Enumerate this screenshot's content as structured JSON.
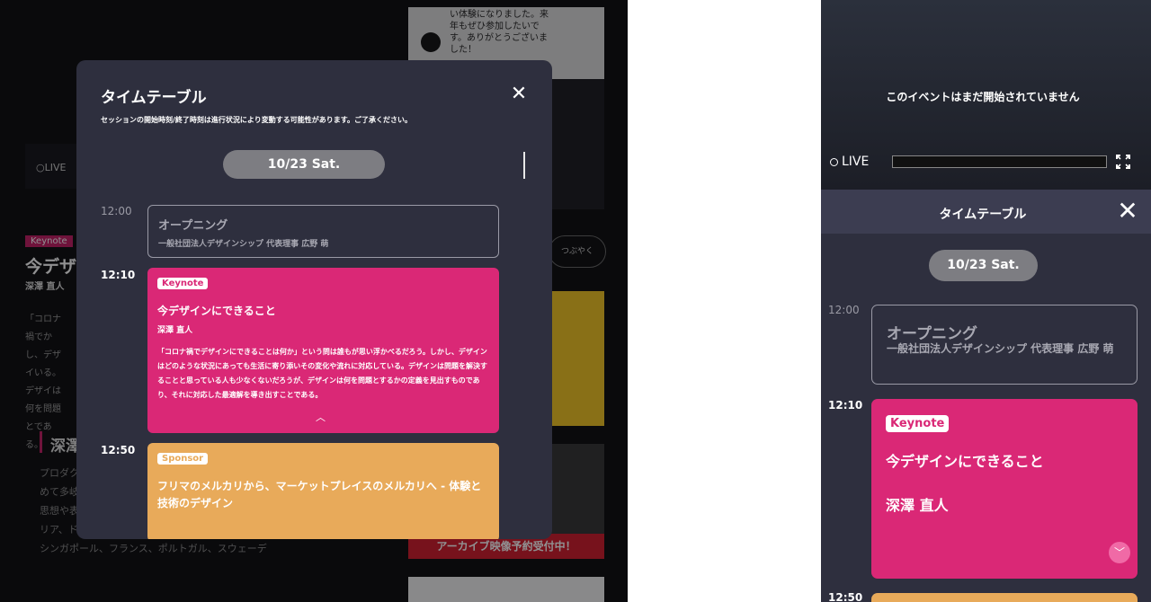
{
  "background": {
    "live_label": "LIVE",
    "badge": "Keynote",
    "title": "今デザイ",
    "speaker": "深澤 直人",
    "para": "「コロナ禍でかし、デザイいる。デザイは何を問題とである。",
    "section_heading": "深澤",
    "bio": "プロダクトを経てサ る。200 のあるデ まで手がけるデザインの領域は極めて多岐に渡る。デザインの本質 ンを通して対象の本質にせまる力、その思想や表現などには国や領域を超えて高 い評価を得ている。現在は、イタリア、ドイツ、アメリカ、スイス、スペイン、 中国、韓国、タイ、台湾、シンガポール、フランス、ポルトガル、スウェーデ",
    "chat_text": "い体験になりました。来年もぜひ参加したいです。ありがとうございました！",
    "tweet_label": "つぶやく",
    "archive_label": "アーカイブ映像予約受付中！"
  },
  "modal": {
    "title": "タイムテーブル",
    "note": "セッションの開始時刻/終了時刻は進行状況により変動する可能性があります。ご了承ください。",
    "date": "10/23 Sat.",
    "sessions": [
      {
        "time": "12:00",
        "title": "オープニング",
        "speaker": "一般社団法人デザインシップ 代表理事 広野 萌"
      },
      {
        "time": "12:10",
        "tag": "Keynote",
        "title": "今デザインにできること",
        "speaker": "深澤 直人",
        "description": "「コロナ禍でデザインにできることは何か」という問は誰もが思い浮かべるだろう。しかし、デザインはどのような状況にあっても生活に寄り添いその変化や流れに対応している。デザインは問題を解決することと思っている人も少なくないだろうが、デザインは何を問題とするかの定義を見出すものであり、それに対応した最適解を導き出すことである。",
        "color": "#da2876"
      },
      {
        "time": "12:50",
        "tag": "Sponsor",
        "title": "フリマのメルカリから、マーケットプレイスのメルカリへ - 体験と技術のデザイン",
        "color": "#e8aa5a"
      }
    ],
    "close_icon": "close-icon",
    "collapse_icon": "chevron-up-icon"
  },
  "mobile": {
    "notice": "このイベントはまだ開始されていません",
    "live_label": "LIVE",
    "title": "タイムテーブル",
    "date": "10/23 Sat.",
    "sessions": [
      {
        "time": "12:00",
        "title": "オープニング",
        "speaker": "一般社団法人デザインシップ 代表理事 広野 萌"
      },
      {
        "time": "12:10",
        "tag": "Keynote",
        "title": "今デザインにできること",
        "speaker": "深澤 直人"
      },
      {
        "time": "12:50"
      }
    ],
    "expand_icon": "chevron-down-icon",
    "fullscreen_icon": "fullscreen-icon"
  }
}
